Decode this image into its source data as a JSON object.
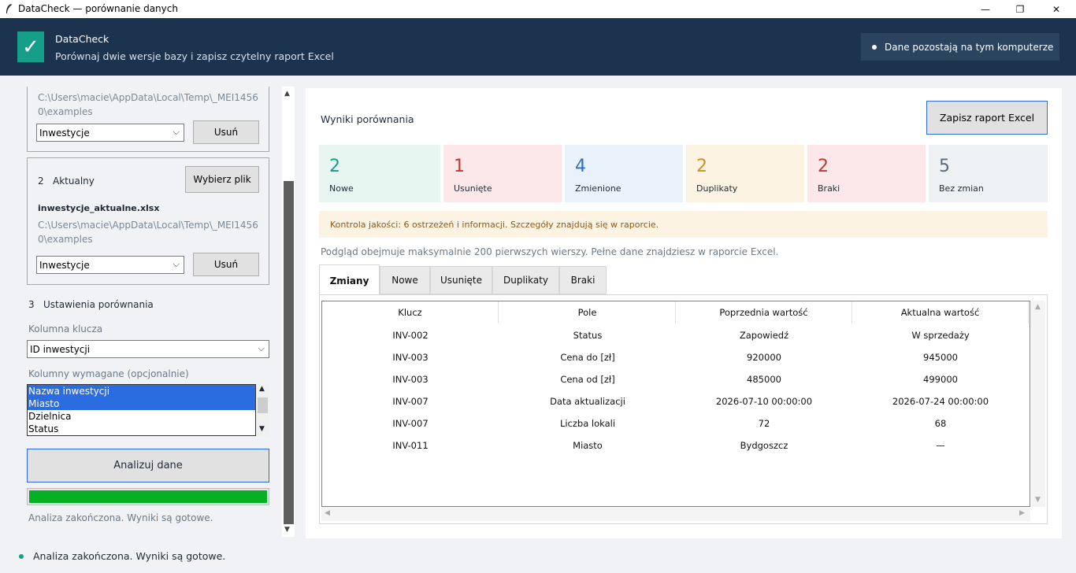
{
  "window": {
    "title": "DataCheck — porównanie danych",
    "minimize": "—",
    "restore": "❐",
    "close": "✕"
  },
  "header": {
    "logo_glyph": "✓",
    "app_name": "DataCheck",
    "subtitle": "Porównaj dwie wersje bazy i zapisz czytelny raport Excel",
    "privacy": "Dane pozostają na tym komputerze"
  },
  "left": {
    "file1": {
      "path": "C:\\Users\\macie\\AppData\\Local\\Temp\\_MEI14560\\examples",
      "sheet": "Inwestycje",
      "remove": "Usuń"
    },
    "file2": {
      "number": "2",
      "title": "Aktualny",
      "choose": "Wybierz plik",
      "filename": "inwestycje_aktualne.xlsx",
      "path": "C:\\Users\\macie\\AppData\\Local\\Temp\\_MEI14560\\examples",
      "sheet": "Inwestycje",
      "remove": "Usuń"
    },
    "settings": {
      "number": "3",
      "title": "Ustawienia porównania",
      "key_label": "Kolumna klucza",
      "key_value": "ID inwestycji",
      "required_label": "Kolumny wymagane (opcjonalnie)"
    },
    "required_columns": [
      {
        "label": "Nazwa inwestycji",
        "selected": true
      },
      {
        "label": "Miasto",
        "selected": true
      },
      {
        "label": "Dzielnica",
        "selected": false
      },
      {
        "label": "Status",
        "selected": false
      }
    ],
    "analyze": "Analizuj dane",
    "progress": 1.0,
    "status": "Analiza zakończona. Wyniki są gotowe."
  },
  "results": {
    "title": "Wyniki porównania",
    "save": "Zapisz raport Excel",
    "stats": [
      {
        "value": "2",
        "label": "Nowe",
        "color": "#169e8a",
        "bg": "#e8f6f2"
      },
      {
        "value": "1",
        "label": "Usunięte",
        "color": "#c0392b",
        "bg": "#fce8ea"
      },
      {
        "value": "4",
        "label": "Zmienione",
        "color": "#2a6fc2",
        "bg": "#e9f1fb"
      },
      {
        "value": "2",
        "label": "Duplikaty",
        "color": "#d0901d",
        "bg": "#fdf3e3"
      },
      {
        "value": "2",
        "label": "Braki",
        "color": "#c0392b",
        "bg": "#fce8ea"
      },
      {
        "value": "5",
        "label": "Bez zmian",
        "color": "#5a6a7e",
        "bg": "#eef1f4"
      }
    ],
    "quality": "Kontrola jakości: 6 ostrzeżeń i informacji. Szczegóły znajdują się w raporcie.",
    "preview_note": "Podgląd obejmuje maksymalnie 200 pierwszych wierszy. Pełne dane znajdziesz w raporcie Excel.",
    "tabs": [
      "Zmiany",
      "Nowe",
      "Usunięte",
      "Duplikaty",
      "Braki"
    ],
    "active_tab": "Zmiany",
    "columns": [
      "Klucz",
      "Pole",
      "Poprzednia wartość",
      "Aktualna wartość"
    ],
    "rows": [
      [
        "INV-002",
        "Status",
        "Zapowiedź",
        "W sprzedaży"
      ],
      [
        "INV-003",
        "Cena do [zł]",
        "920000",
        "945000"
      ],
      [
        "INV-003",
        "Cena od [zł]",
        "485000",
        "499000"
      ],
      [
        "INV-007",
        "Data aktualizacji",
        "2026-07-10 00:00:00",
        "2026-07-24 00:00:00"
      ],
      [
        "INV-007",
        "Liczba lokali",
        "72",
        "68"
      ],
      [
        "INV-011",
        "Miasto",
        "Bydgoszcz",
        "—"
      ]
    ]
  },
  "statusbar": {
    "text": "Analiza zakończona. Wyniki są gotowe."
  }
}
